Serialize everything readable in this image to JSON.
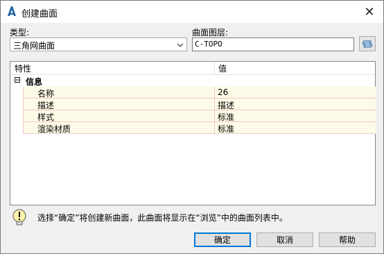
{
  "window": {
    "title": "创建曲面",
    "close_glyph": "✕"
  },
  "form": {
    "type_label": "类型:",
    "type_value": "三角网曲面",
    "layer_label": "曲面图层:",
    "layer_value": "C-TOPO"
  },
  "grid": {
    "headers": {
      "property": "特性",
      "value": "值"
    },
    "category": {
      "toggle": "⊟",
      "label": "信息"
    },
    "rows": [
      {
        "name": "名称",
        "value": "26"
      },
      {
        "name": "描述",
        "value": "描述"
      },
      {
        "name": "样式",
        "value": "标准"
      },
      {
        "name": "渲染材质",
        "value": "标准"
      }
    ]
  },
  "info": {
    "message": "选择“确定”将创建新曲面，此曲面将显示在“浏览”中的曲面列表中。"
  },
  "buttons": {
    "ok": "确定",
    "cancel": "取消",
    "help": "帮助"
  },
  "icons": {
    "app": "autocad-a-icon",
    "layer": "layers-icon",
    "info": "lightbulb-info-icon",
    "dropdown": "chevron-down-icon"
  },
  "colors": {
    "accent": "#0078d7",
    "row_bg": "#fdfbe7"
  }
}
